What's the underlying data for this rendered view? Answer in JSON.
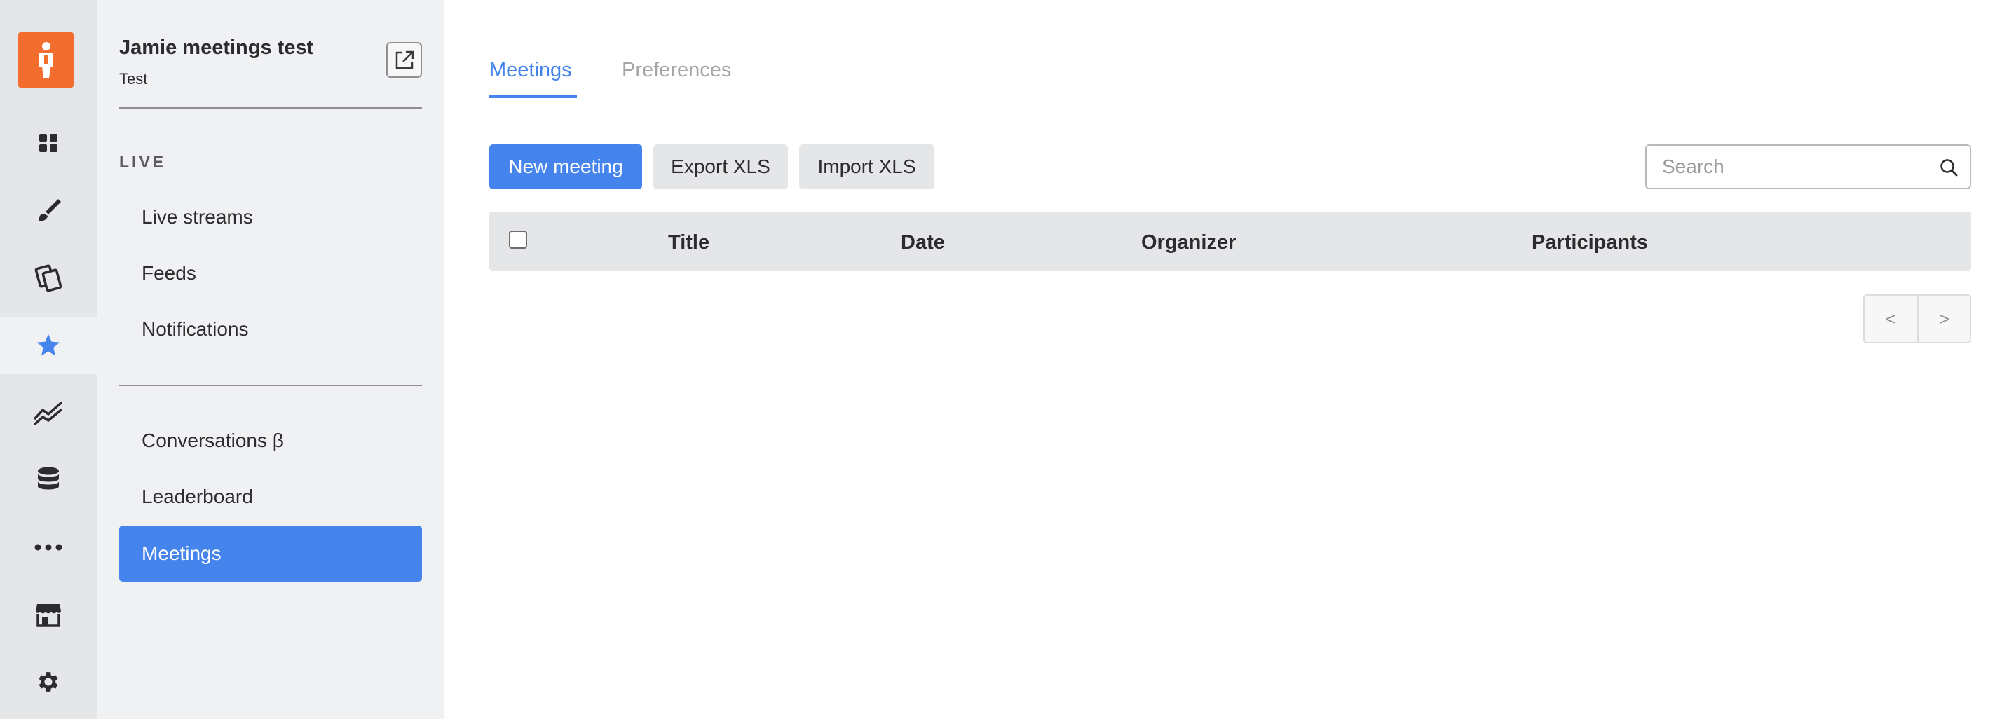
{
  "rail": {
    "items": [
      {
        "icon": "dashboard-icon"
      },
      {
        "icon": "brush-icon"
      },
      {
        "icon": "cards-icon"
      },
      {
        "icon": "star-icon",
        "active": true
      },
      {
        "icon": "analytics-icon"
      },
      {
        "icon": "database-icon"
      },
      {
        "icon": "more-icon"
      },
      {
        "icon": "store-icon"
      },
      {
        "icon": "settings-icon"
      }
    ],
    "accent_color": "#4584ec",
    "logo_color": "#f36e2e"
  },
  "project": {
    "title": "Jamie meetings test",
    "subtitle": "Test"
  },
  "sidebar": {
    "section_label": "LIVE",
    "live_items": [
      {
        "label": "Live streams"
      },
      {
        "label": "Feeds"
      },
      {
        "label": "Notifications"
      }
    ],
    "other_items": [
      {
        "label": "Conversations β"
      },
      {
        "label": "Leaderboard"
      },
      {
        "label": "Meetings",
        "active": true
      }
    ]
  },
  "tabs": [
    {
      "label": "Meetings",
      "active": true
    },
    {
      "label": "Preferences",
      "active": false
    }
  ],
  "toolbar": {
    "new_meeting": "New meeting",
    "export_xls": "Export XLS",
    "import_xls": "Import XLS"
  },
  "search": {
    "placeholder": "Search",
    "value": ""
  },
  "table": {
    "columns": [
      "Title",
      "Date",
      "Organizer",
      "Participants"
    ],
    "rows": []
  },
  "pagination": {
    "prev": "<",
    "next": ">"
  }
}
